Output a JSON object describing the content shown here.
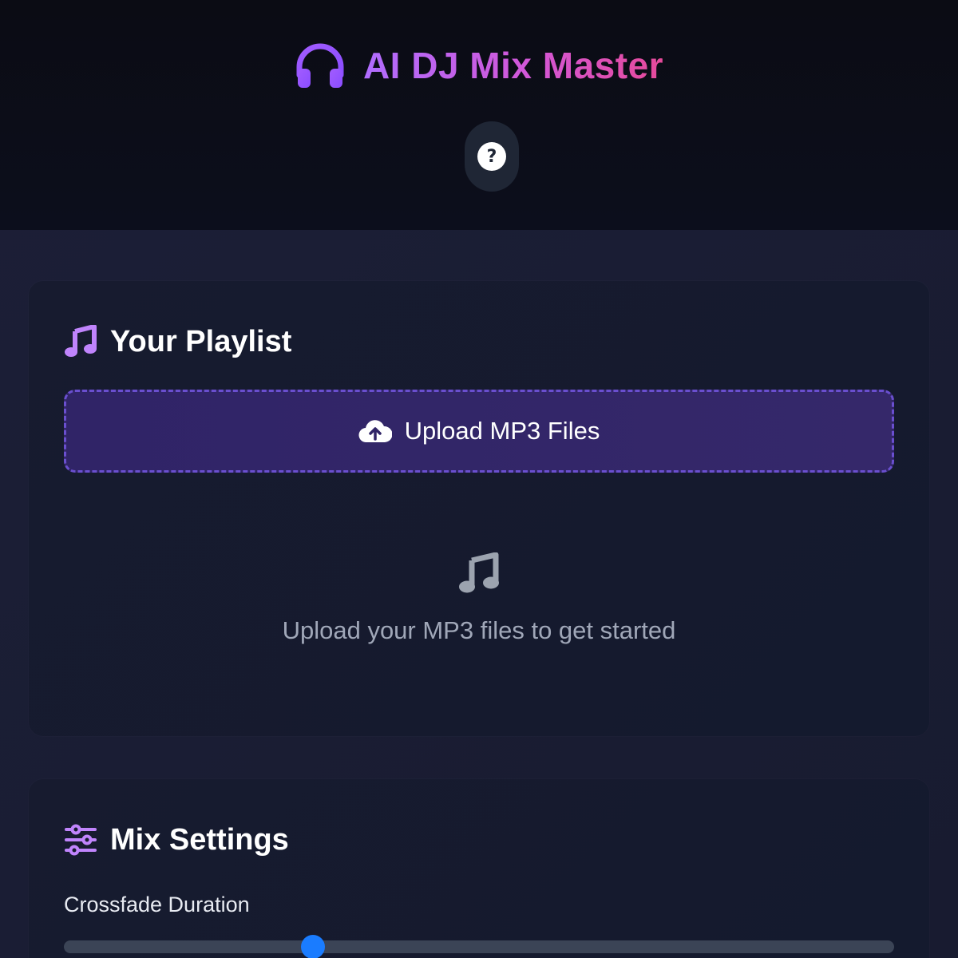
{
  "header": {
    "title": "AI DJ Mix Master",
    "logo_icon": "headphones-icon",
    "help_icon": "question-circle-icon",
    "help_glyph": "?"
  },
  "playlist": {
    "heading": "Your Playlist",
    "heading_icon": "music-note-icon",
    "upload_label": "Upload MP3 Files",
    "upload_icon": "cloud-upload-icon",
    "empty_icon": "music-note-icon",
    "empty_text": "Upload your MP3 files to get started"
  },
  "mix_settings": {
    "heading": "Mix Settings",
    "heading_icon": "sliders-icon",
    "crossfade_label": "Crossfade Duration",
    "crossfade_fraction": 0.3
  },
  "colors": {
    "accent_purple": "#b06dff",
    "accent_pink": "#e64a9a",
    "slider_thumb": "#1a7cff",
    "upload_border": "#6a4fcf"
  }
}
